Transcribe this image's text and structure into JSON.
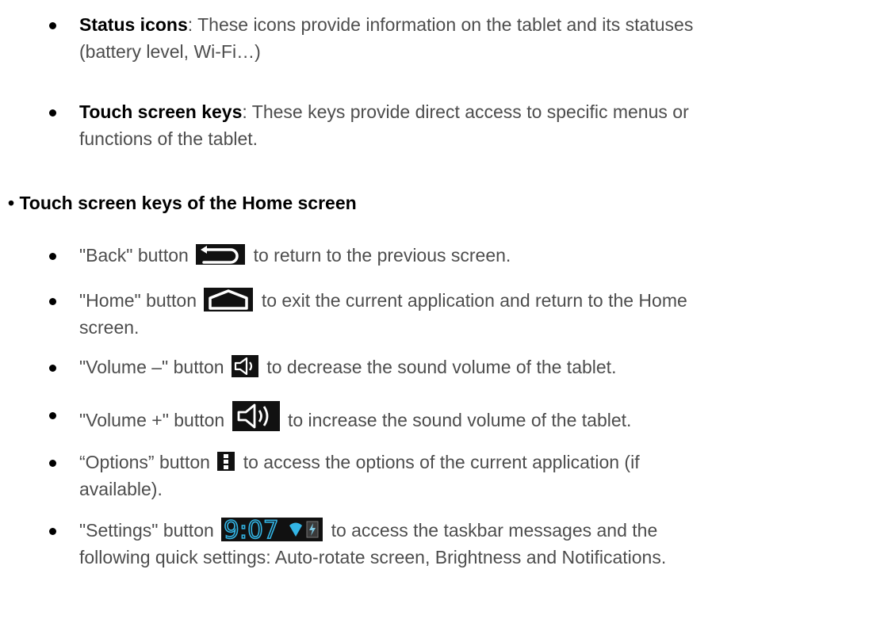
{
  "status_icons": {
    "term": "Status icons",
    "text_line1": ": These icons provide information on the tablet and its statuses",
    "text_line2": "(battery level, Wi-Fi…)"
  },
  "touch_keys": {
    "term": "Touch screen keys",
    "text_line1": ": These keys provide direct access to specific menus or",
    "text_line2": "functions of the tablet."
  },
  "heading": "• Touch screen keys of the Home screen",
  "back": {
    "prefix": "\"Back\" button",
    "suffix": " to return to the previous screen.",
    "icon": "back-arrow-icon"
  },
  "home": {
    "prefix": "\"Home\" button",
    "suffix": "to exit the current application and return to the Home",
    "suffix_line2": "screen.",
    "icon": "home-icon"
  },
  "volume_down": {
    "prefix": "\"Volume –\" button",
    "suffix": " to decrease the sound volume of the tablet.",
    "icon": "volume-down-icon"
  },
  "volume_up": {
    "prefix": "\"Volume +\" button",
    "suffix": " to increase the sound volume of the tablet.",
    "icon": "volume-up-icon"
  },
  "options": {
    "prefix": "“Options” button",
    "suffix": "to access the options of the current application (if",
    "suffix_line2": "available).",
    "icon": "options-menu-icon"
  },
  "settings": {
    "prefix": "\"Settings\" button",
    "clock_text": "9:07",
    "suffix": "to access the taskbar messages and the",
    "suffix_line2": "following quick settings: Auto-rotate screen, Brightness and Notifications.",
    "icon": "status-bar-icon"
  },
  "colors": {
    "body_text": "#4d4d4d",
    "bold_text": "#000000",
    "icon_bg": "#111111",
    "clock_blue": "#33b5e5"
  }
}
